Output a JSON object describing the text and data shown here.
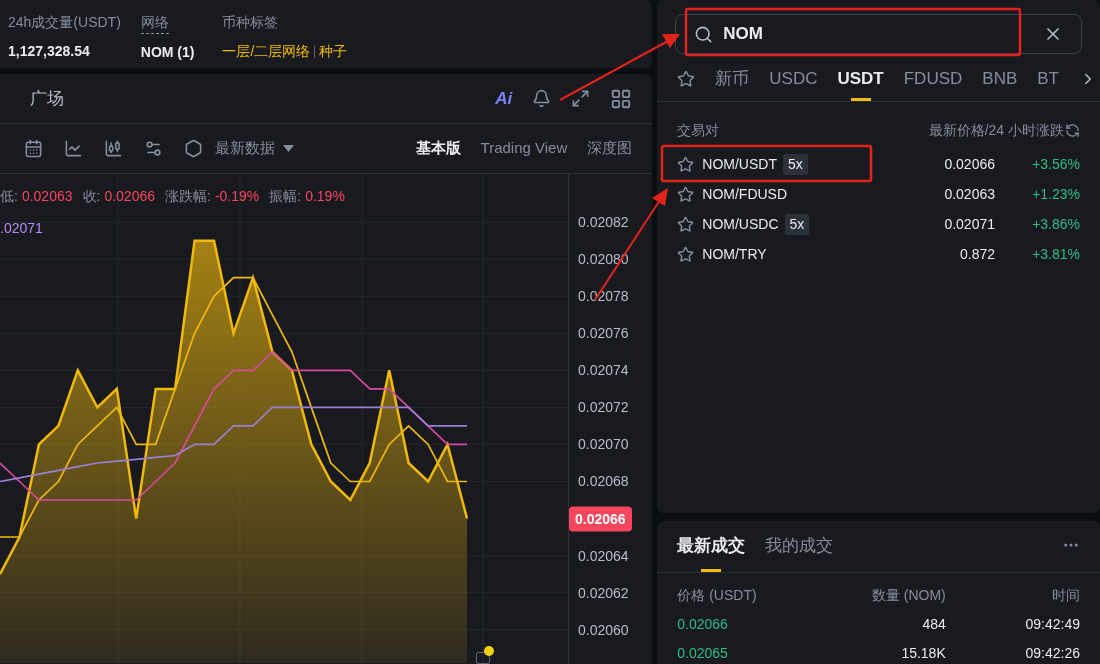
{
  "stats": [
    {
      "label": "24h成交量(USDT)",
      "value": "1,127,328.54",
      "kind": "plain"
    },
    {
      "label": "网络",
      "value": "NOM (1)",
      "kind": "dashed"
    }
  ],
  "tags": {
    "label": "币种标签",
    "items": [
      "一层/二层网络",
      "种子"
    ]
  },
  "chart_panel": {
    "tab": "广场",
    "ai_label": "Ai",
    "toolbar": {
      "dropdown": "最新数据",
      "views": [
        {
          "label": "基本版",
          "selected": true
        },
        {
          "label": "Trading View",
          "selected": false
        },
        {
          "label": "深度图",
          "selected": false
        }
      ]
    },
    "ohlc": [
      {
        "label": "低:",
        "value": "0.02063"
      },
      {
        "label": "收:",
        "value": "0.02066"
      },
      {
        "label": "涨跌幅:",
        "value": "-0.19%"
      },
      {
        "label": "振幅:",
        "value": "0.19%"
      }
    ],
    "ma_reading": ".02071",
    "price_badge": "0.02066",
    "chart_data": {
      "type": "area",
      "grid": true,
      "ylim": [
        0.020582,
        0.020846
      ],
      "yticks": [
        {
          "value": 0.02082,
          "label": "0.02082"
        },
        {
          "value": 0.0208,
          "label": "0.02080"
        },
        {
          "value": 0.02078,
          "label": "0.02078"
        },
        {
          "value": 0.02076,
          "label": "0.02076"
        },
        {
          "value": 0.02074,
          "label": "0.02074"
        },
        {
          "value": 0.02072,
          "label": "0.02072"
        },
        {
          "value": 0.0207,
          "label": "0.02070"
        },
        {
          "value": 0.02068,
          "label": "0.02068"
        },
        {
          "value": 0.02064,
          "label": "0.02064"
        },
        {
          "value": 0.02062,
          "label": "0.02062"
        },
        {
          "value": 0.0206,
          "label": "0.02060"
        }
      ],
      "series": [
        {
          "type": "area",
          "color": "#f0b90b",
          "values": [
            0.02063,
            0.02065,
            0.0207,
            0.02071,
            0.02074,
            0.02072,
            0.02073,
            0.02066,
            0.02073,
            0.02073,
            0.02081,
            0.02081,
            0.02076,
            0.02079,
            0.02075,
            0.02074,
            0.0207,
            0.02068,
            0.02067,
            0.02069,
            0.02074,
            0.02069,
            0.02068,
            0.0207,
            0.02066
          ]
        },
        {
          "type": "line",
          "color": "#f0b90b",
          "values": [
            0.02065,
            0.02065,
            0.02067,
            0.02068,
            0.0207,
            0.02071,
            0.02072,
            0.0207,
            0.0207,
            0.02073,
            0.02076,
            0.02078,
            0.02079,
            0.02079,
            0.02077,
            0.02075,
            0.02072,
            0.02069,
            0.02068,
            0.02068,
            0.0207,
            0.02071,
            0.0207,
            0.02068,
            0.02068
          ]
        },
        {
          "type": "line",
          "color": "#d9499c",
          "values": [
            0.02069,
            0.02068,
            0.02067,
            0.02067,
            0.02067,
            0.02067,
            0.02067,
            0.02067,
            0.02068,
            0.02069,
            0.02071,
            0.02073,
            0.02074,
            0.02074,
            0.02075,
            0.02074,
            0.02074,
            0.02074,
            0.02074,
            0.02073,
            0.02073,
            0.02072,
            0.02071,
            0.0207,
            0.0207
          ]
        },
        {
          "type": "line",
          "color": "#9b7fd1",
          "values": [
            0.02068,
            0.020682,
            0.020684,
            0.020686,
            0.020688,
            0.02069,
            0.020691,
            0.020692,
            0.020693,
            0.020694,
            0.0207,
            0.0207,
            0.02071,
            0.02071,
            0.02072,
            0.02072,
            0.02072,
            0.02072,
            0.02072,
            0.02072,
            0.02072,
            0.02072,
            0.02071,
            0.02071,
            0.02071
          ]
        }
      ]
    }
  },
  "market": {
    "search": {
      "value": "NOM"
    },
    "tabs": [
      {
        "label": "新币",
        "selected": false
      },
      {
        "label": "USDC",
        "selected": false
      },
      {
        "label": "USDT",
        "selected": true
      },
      {
        "label": "FDUSD",
        "selected": false
      },
      {
        "label": "BNB",
        "selected": false
      },
      {
        "label": "BT",
        "selected": false
      }
    ],
    "columns": [
      "交易对",
      "最新价格/24 小时涨跌"
    ],
    "rows": [
      {
        "pair": "NOM/USDT",
        "leverage": "5x",
        "price": "0.02066",
        "change": "+3.56%"
      },
      {
        "pair": "NOM/FDUSD",
        "price": "0.02063",
        "change": "+1.23%"
      },
      {
        "pair": "NOM/USDC",
        "leverage": "5x",
        "price": "0.02071",
        "change": "+3.86%"
      },
      {
        "pair": "NOM/TRY",
        "price": "0.872",
        "change": "+3.81%"
      }
    ]
  },
  "trades": {
    "tabs": [
      {
        "label": "最新成交",
        "selected": true
      },
      {
        "label": "我的成交",
        "selected": false
      }
    ],
    "columns": [
      "价格 (USDT)",
      "数量 (NOM)",
      "时间"
    ],
    "rows": [
      {
        "price": "0.02066",
        "amount": "484",
        "time": "09:42:49"
      },
      {
        "price": "0.02065",
        "amount": "15.18K",
        "time": "09:42:26"
      }
    ]
  }
}
